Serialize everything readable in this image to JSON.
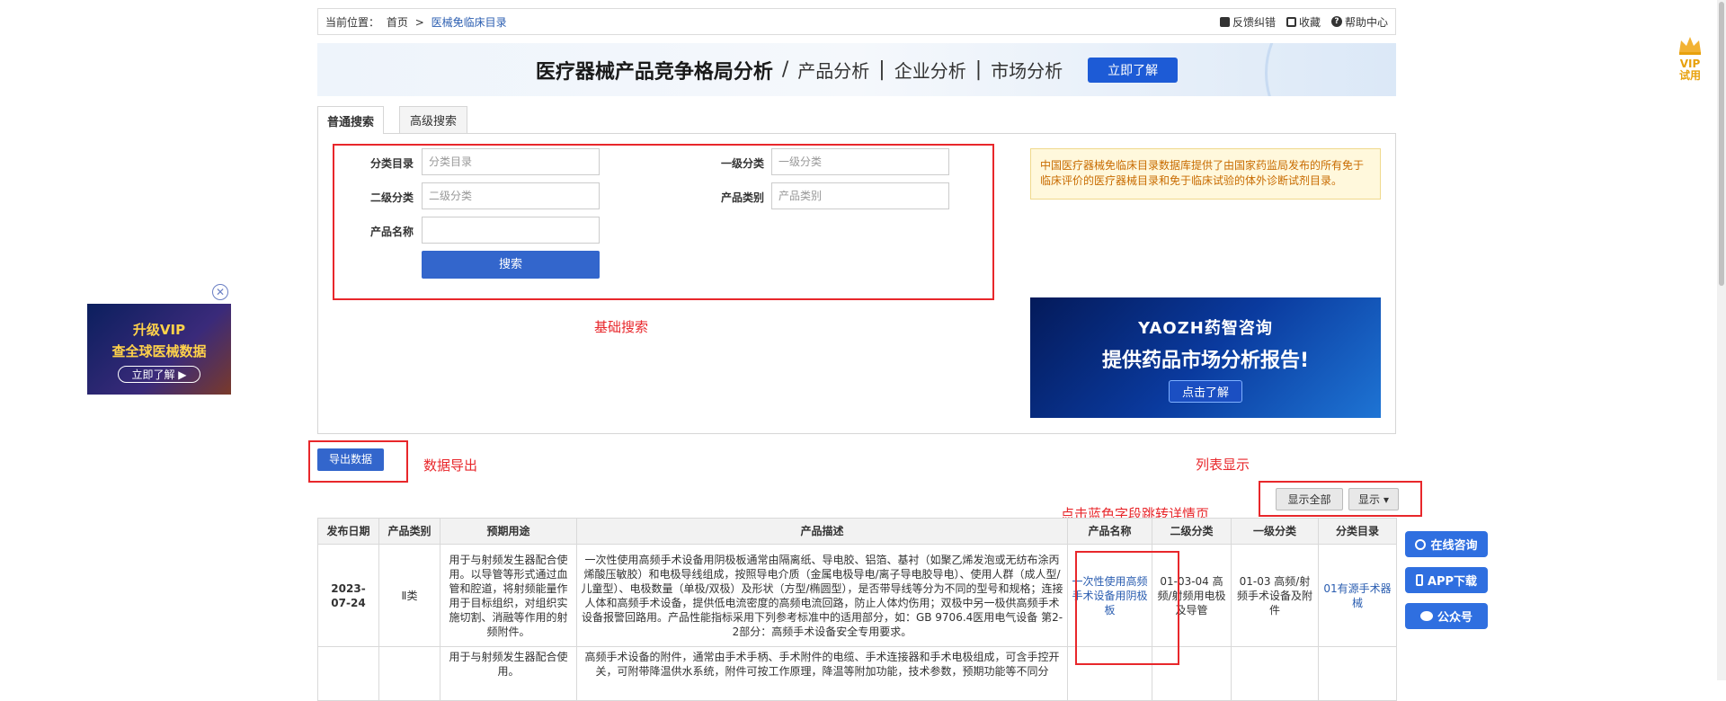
{
  "breadcrumb": {
    "label": "当前位置：",
    "home": "首页",
    "sep": ">",
    "current": "医械免临床目录"
  },
  "toolbar": {
    "feedback": "反馈纠错",
    "favorite": "收藏",
    "help": "帮助中心"
  },
  "banner": {
    "title": "医疗器械产品竞争格局分析",
    "sep": "/",
    "item1": "产品分析",
    "item2": "企业分析",
    "item3": "市场分析",
    "pipe": "|",
    "button": "立即了解"
  },
  "tabs": {
    "basic": "普通搜索",
    "advanced": "高级搜索"
  },
  "form": {
    "catalog_label": "分类目录",
    "catalog_placeholder": "分类目录",
    "level1_label": "一级分类",
    "level1_placeholder": "一级分类",
    "level2_label": "二级分类",
    "level2_placeholder": "二级分类",
    "category_label": "产品类别",
    "category_placeholder": "产品类别",
    "name_label": "产品名称",
    "name_value": "",
    "search_button": "搜索"
  },
  "notice": "中国医疗器械免临床目录数据库提供了由国家药监局发布的所有免于临床评价的医疗器械目录和免于临床试验的体外诊断试剂目录。",
  "annotations": {
    "basic_search": "基础搜索",
    "data_export": "数据导出",
    "list_display": "列表显示",
    "click_blue": "点击蓝色字段跳转详情页"
  },
  "ad_right": {
    "logo": "YAOZH药智咨询",
    "slogan": "提供药品市场分析报告!",
    "cta": "点击了解"
  },
  "ad_left": {
    "line1": "升级VIP",
    "line2": "查全球医械数据",
    "cta": "立即了解 ▶",
    "close": "✕"
  },
  "export_button": "导出数据",
  "show_all_button": "显示全部",
  "show_button": "显示",
  "table": {
    "headers": [
      "发布日期",
      "产品类别",
      "预期用途",
      "产品描述",
      "产品名称",
      "二级分类",
      "一级分类",
      "分类目录"
    ],
    "rows": [
      {
        "date": "2023-07-24",
        "category": "Ⅱ类",
        "usage": "用于与射频发生器配合使用。以导管等形式通过血管和腔道，将射频能量作用于目标组织，对组织实施切割、消融等作用的射频附件。",
        "desc": "一次性使用高频手术设备用阴极板通常由隔离纸、导电胶、铝箔、基衬（如聚乙烯发泡或无纺布涂丙烯酸压敏胶）和电极导线组成，按照导电介质（金属电极导电/离子导电胶导电）、使用人群（成人型/儿童型）、电极数量（单极/双极）及形状（方型/椭圆型），是否带导线等分为不同的型号和规格；连接人体和高频手术设备，提供低电流密度的高频电流回路，防止人体灼伤用；双极中另一极供高频手术设备报警回路用。产品性能指标采用下列参考标准中的适用部分，如：GB 9706.4医用电气设备 第2-2部分：高频手术设备安全专用要求。",
        "name": "一次性使用高频手术设备用阴极板",
        "level2": "01-03-04 高频/射频用电极及导管",
        "level1": "01-03 高频/射频手术设备及附件",
        "catalog": "01有源手术器械"
      },
      {
        "date": "",
        "category": "",
        "usage": "用于与射频发生器配合使用。",
        "desc": "高频手术设备的附件，通常由手术手柄、手术附件的电缆、手术连接器和手术电极组成，可含手控开关，可附带降温供水系统，附件可按工作原理，降温等附加功能，技术参数，预期功能等不同分",
        "name": "",
        "level2": "",
        "level1": "",
        "catalog": ""
      }
    ]
  },
  "float": {
    "consult": "在线咨询",
    "app": "APP下载",
    "wechat": "公众号"
  },
  "vip": {
    "line1": "VIP",
    "line2": "试用"
  }
}
